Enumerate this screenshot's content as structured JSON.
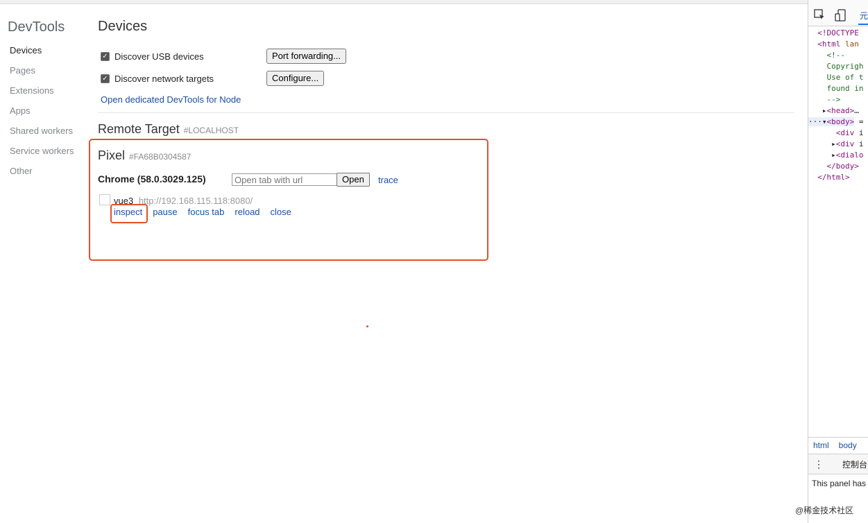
{
  "sidebar": {
    "title": "DevTools",
    "items": [
      {
        "label": "Devices",
        "active": true
      },
      {
        "label": "Pages"
      },
      {
        "label": "Extensions"
      },
      {
        "label": "Apps"
      },
      {
        "label": "Shared workers"
      },
      {
        "label": "Service workers"
      },
      {
        "label": "Other"
      }
    ]
  },
  "devices": {
    "heading": "Devices",
    "discover_usb": {
      "label": "Discover USB devices",
      "checked": true,
      "button": "Port forwarding..."
    },
    "discover_network": {
      "label": "Discover network targets",
      "checked": true,
      "button": "Configure..."
    },
    "node_link": "Open dedicated DevTools for Node"
  },
  "remote": {
    "heading": "Remote Target",
    "id": "#LOCALHOST",
    "device": {
      "name": "Pixel",
      "serial": "#FA68B0304587",
      "browser": "Chrome (58.0.3029.125)",
      "url_placeholder": "Open tab with url",
      "open_button": "Open",
      "trace_link": "trace",
      "page": {
        "title": "vue3",
        "url": "http://192.168.115.118:8080/",
        "actions": [
          "inspect",
          "pause",
          "focus tab",
          "reload",
          "close"
        ]
      }
    }
  },
  "devtools_panel": {
    "tab_label": "元",
    "breadcrumbs": [
      "html",
      "body"
    ],
    "drawer_tab": "控制台",
    "panel_message": "This panel has"
  },
  "watermark": "@稀金技术社区",
  "colors": {
    "accent_red": "#e2502a",
    "link": "#1a4fa0"
  }
}
